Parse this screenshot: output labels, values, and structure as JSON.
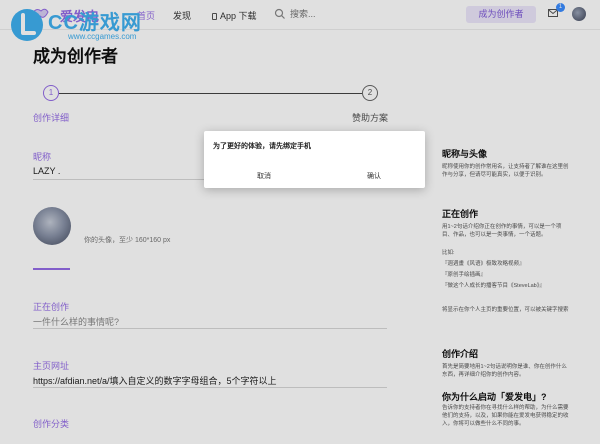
{
  "nav": {
    "brand": "爱发电",
    "links": [
      "首页",
      "发现",
      "App 下载"
    ],
    "search_placeholder": "搜索...",
    "creator_button": "成为创作者",
    "notification_count": "1"
  },
  "watermark": {
    "text": "CC游戏网",
    "sub": "www.ccgames.com"
  },
  "page": {
    "title": "成为创作者",
    "steps": [
      {
        "number": "1",
        "label": "创作详细"
      },
      {
        "number": "2",
        "label": "赞助方案"
      }
    ],
    "nickname": {
      "label": "昵称",
      "value": "LAZY ."
    },
    "avatar_hint": "你的头像，至少 160*160 px",
    "creating": {
      "label": "正在创作",
      "placeholder": "一件什么样的事情呢?"
    },
    "homepage": {
      "label": "主页网址",
      "value": "https://afdian.net/a/填入自定义的数字字母组合，5个字符以上"
    },
    "category": {
      "label": "创作分类"
    }
  },
  "sidebar": {
    "sections": [
      {
        "heading": "昵称与头像",
        "text": "昵称使用你的创作常用名，让支持者了解谁在这里创作与分享，但请尽可能真实，以便于识别。"
      },
      {
        "heading": "正在创作",
        "text": "用1~2句话介绍你正在创作的事情，可以是一个项目、作品，也可以是一类事情，一个话题。",
        "examples_label": "比如:",
        "examples": [
          "『週週畫《风语》极致攻略视频』",
          "『原创手绘插画』",
          "『做这个人成长的播客节目《SteveLab》』"
        ],
        "note": "将显示在你个人主页的重要位置，可以被关键字搜索"
      },
      {
        "heading": "创作介绍",
        "text": "首先是简要地用1~2句话说明你是谁、你在创作什么东西，再详细介绍你的创作内容。"
      },
      {
        "heading": "你为什么启动「爱发电」?",
        "text": "告诉你的支持者你在寻找什么样的帮助，为什么需要他们的支持，以及，如果你能在爱发电获得稳定的收入，你将可以做些什么不同的事。"
      }
    ]
  },
  "modal": {
    "message": "为了更好的体验，请先绑定手机",
    "cancel": "取消",
    "confirm": "确认"
  },
  "colors": {
    "accent": "#946ce6",
    "watermark": "#3fb0f0"
  }
}
